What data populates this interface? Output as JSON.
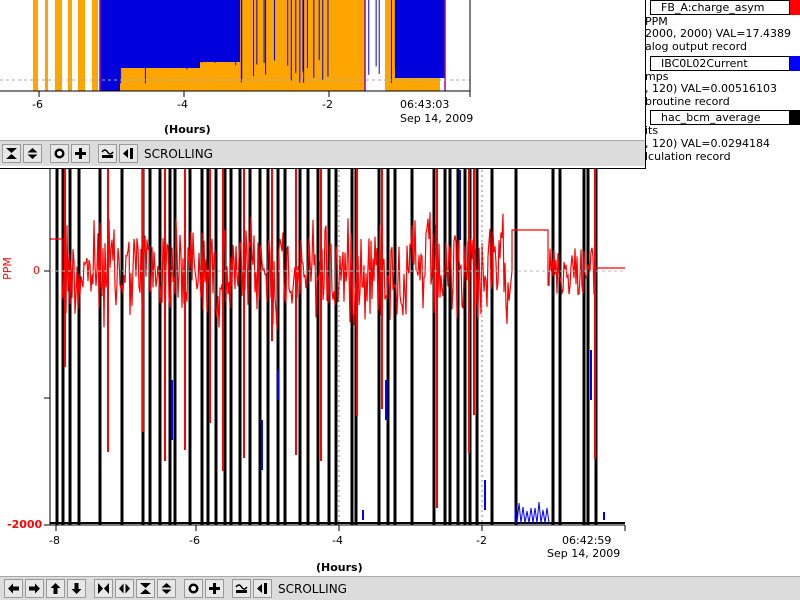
{
  "main_plot": {
    "y_axis_title": "PPM",
    "y_tick_labels": [
      "0",
      "-2000"
    ],
    "x_tick_labels": [
      "-8",
      "-6",
      "-4",
      "-2"
    ],
    "x_axis_title": "(Hours)",
    "time_label": "06:42:59",
    "date_label": "Sep 14, 2009",
    "colors": {
      "charge_asym": "#ff0000",
      "current": "#000000",
      "bcm": "#0000ff"
    }
  },
  "overlay_plot": {
    "x_tick_labels": [
      "-6",
      "-4",
      "-2"
    ],
    "x_axis_title": "(Hours)",
    "time_label": "06:43:03",
    "date_label": "Sep 14, 2009",
    "colors": {
      "fill": "#ffa500",
      "bars": "#0000dd"
    }
  },
  "toolbar_main": {
    "buttons": [
      "left-arrow-icon",
      "right-arrow-icon",
      "up-arrow-icon",
      "down-arrow-icon",
      "zoom-in-x-icon",
      "zoom-out-x-icon",
      "zoom-in-y-icon",
      "zoom-out-y-icon",
      "autoscale-icon",
      "add-icon",
      "fit-icon",
      "back-icon"
    ],
    "label": "SCROLLING"
  },
  "toolbar_overlay": {
    "buttons": [
      "zoom-in-y-icon",
      "zoom-out-y-icon",
      "autoscale-icon",
      "add-icon",
      "fit-icon",
      "back-icon"
    ],
    "label": "SCROLLING"
  },
  "pv_panel": {
    "pv1": {
      "name": "FB_A:charge_asym",
      "color": "#ff0000",
      "units": "PPM",
      "limits": "2000, 2000) VAL=17.4389",
      "desc": "alog output record"
    },
    "pv2": {
      "name": "IBC0L02Current",
      "color": "#0000ff",
      "units": "mps",
      "limits": ", 120) VAL=0.00516103",
      "desc": "broutine record"
    },
    "pv3": {
      "name": "hac_bcm_average",
      "color": "#000000",
      "units": "its",
      "limits": ", 120) VAL=0.0294184",
      "desc": "lculation record"
    }
  }
}
